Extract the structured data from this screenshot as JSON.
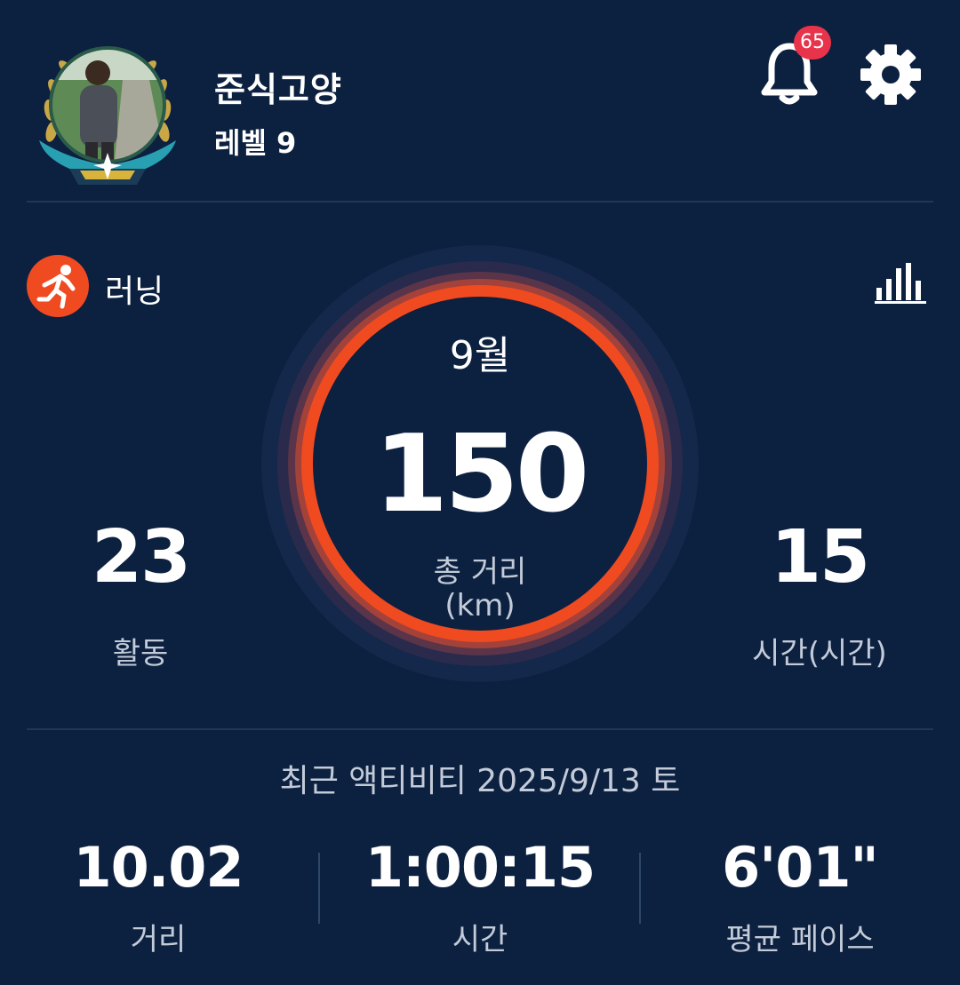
{
  "profile": {
    "name": "준식고양",
    "level": "레벨 9"
  },
  "notifications": {
    "count": "65"
  },
  "sport": {
    "label": "러닝"
  },
  "summary": {
    "month": "9월",
    "total_distance": "150",
    "total_distance_label": "총 거리",
    "total_distance_unit": "(km)",
    "activities_value": "23",
    "activities_label": "활동",
    "hours_value": "15",
    "hours_label": "시간(시간)"
  },
  "recent": {
    "title": "최근 액티비티 2025/9/13 토",
    "distance_value": "10.02",
    "distance_label": "거리",
    "time_value": "1:00:15",
    "time_label": "시간",
    "pace_value": "6'01\"",
    "pace_label": "평균 페이스"
  },
  "colors": {
    "background": "#0c2040",
    "accent": "#f04a20",
    "badge": "#e8334a",
    "muted_text": "#c3cbd8"
  },
  "icons": {
    "notifications": "bell-icon",
    "settings": "gear-icon",
    "sport": "running-icon",
    "stats": "bar-chart-icon"
  }
}
